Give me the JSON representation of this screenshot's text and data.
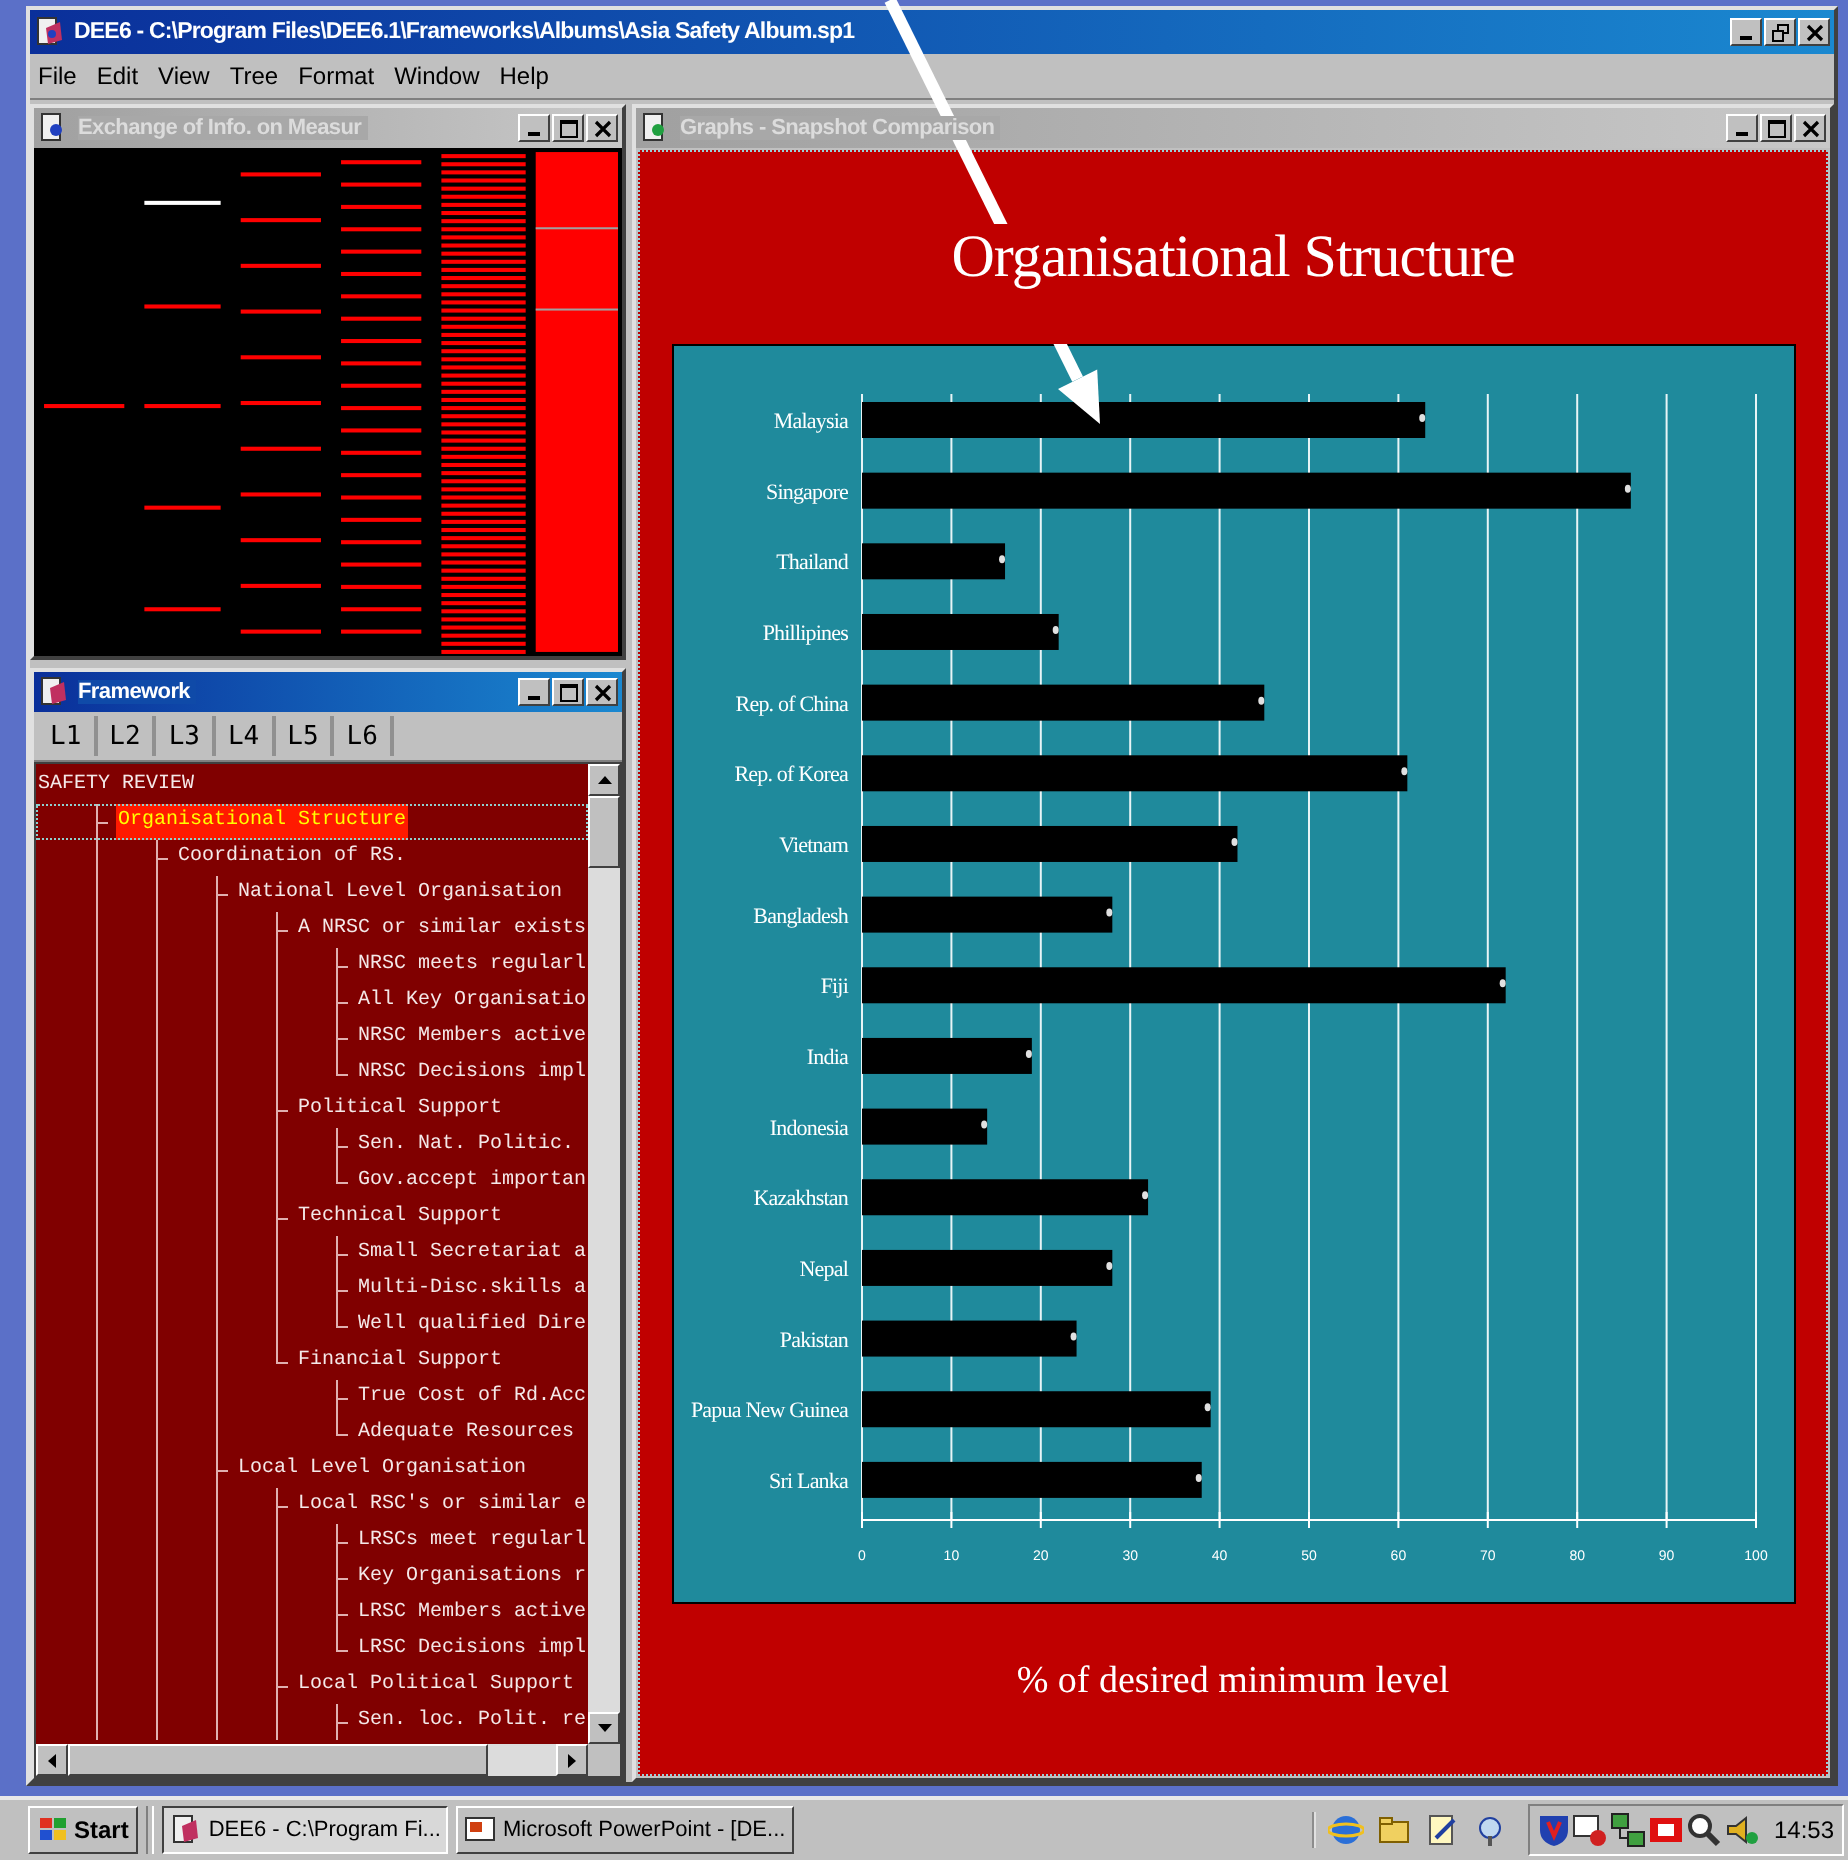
{
  "window": {
    "title": "DEE6 - C:\\Program Files\\DEE6.1\\Frameworks\\Albums\\Asia Safety Album.sp1"
  },
  "menu": [
    "File",
    "Edit",
    "View",
    "Tree",
    "Format",
    "Window",
    "Help"
  ],
  "exchange_window": {
    "title": "Exchange of Info. on Measur",
    "active": false
  },
  "framework_window": {
    "title": "Framework",
    "active": true,
    "level_tabs": [
      "L1",
      "L2",
      "L3",
      "L4",
      "L5",
      "L6"
    ],
    "tree": [
      {
        "label": "SAFETY REVIEW",
        "selected": false,
        "children": [
          {
            "label": "Organisational Structure",
            "selected": true,
            "children": [
              {
                "label": "Coordination of RS.",
                "selected": false,
                "children": [
                  {
                    "label": "National Level Organisation",
                    "selected": false,
                    "children": [
                      {
                        "label": "A NRSC or similar exists",
                        "selected": false,
                        "children": [
                          {
                            "label": "NRSC meets regularl",
                            "selected": false
                          },
                          {
                            "label": "All Key Organisatio",
                            "selected": false
                          },
                          {
                            "label": "NRSC Members active",
                            "selected": false
                          },
                          {
                            "label": "NRSC Decisions impl",
                            "selected": false
                          }
                        ]
                      },
                      {
                        "label": "Political Support",
                        "selected": false,
                        "children": [
                          {
                            "label": "Sen. Nat. Politic.",
                            "selected": false
                          },
                          {
                            "label": "Gov.accept importan",
                            "selected": false
                          }
                        ]
                      },
                      {
                        "label": "Technical Support",
                        "selected": false,
                        "children": [
                          {
                            "label": "Small Secretariat a",
                            "selected": false
                          },
                          {
                            "label": "Multi-Disc.skills a",
                            "selected": false
                          },
                          {
                            "label": "Well qualified Dire",
                            "selected": false
                          }
                        ]
                      },
                      {
                        "label": "Financial Support",
                        "selected": false,
                        "children": [
                          {
                            "label": "True Cost of Rd.Acc",
                            "selected": false
                          },
                          {
                            "label": "Adequate Resources",
                            "selected": false
                          }
                        ]
                      }
                    ]
                  },
                  {
                    "label": "Local Level Organisation",
                    "selected": false,
                    "children": [
                      {
                        "label": "Local RSC's or similar e",
                        "selected": false,
                        "children": [
                          {
                            "label": "LRSCs meet regularl",
                            "selected": false
                          },
                          {
                            "label": "Key Organisations r",
                            "selected": false
                          },
                          {
                            "label": "LRSC Members active",
                            "selected": false
                          },
                          {
                            "label": "LRSC Decisions impl",
                            "selected": false
                          }
                        ]
                      },
                      {
                        "label": "Local Political Support",
                        "selected": false,
                        "children": [
                          {
                            "label": "Sen. loc. Polit. re",
                            "selected": false
                          }
                        ]
                      }
                    ]
                  }
                ]
              }
            ]
          }
        ]
      }
    ]
  },
  "graphs_window": {
    "title": "Graphs - Snapshot Comparison",
    "active": false,
    "chart_data": {
      "type": "bar",
      "orientation": "horizontal",
      "title": "Organisational Structure",
      "xlabel": "% of desired minimum level",
      "categories": [
        "Malaysia",
        "Singapore",
        "Thailand",
        "Phillipines",
        "Rep. of China",
        "Rep. of Korea",
        "Vietnam",
        "Bangladesh",
        "Fiji",
        "India",
        "Indonesia",
        "Kazakhstan",
        "Nepal",
        "Pakistan",
        "Papua New Guinea",
        "Sri Lanka"
      ],
      "series": [
        {
          "color": "#000000",
          "values": [
            63,
            86,
            16,
            22,
            45,
            61,
            42,
            28,
            72,
            19,
            14,
            32,
            28,
            24,
            39,
            38
          ]
        }
      ],
      "grid": true,
      "xlim": [
        0,
        100
      ],
      "xticks": [
        0,
        10,
        20,
        30,
        40,
        50,
        60,
        70,
        80,
        90,
        100
      ]
    }
  },
  "taskbar": {
    "start": "Start",
    "tasks": [
      {
        "label": "DEE6 - C:\\Program Fi...",
        "selected": true
      },
      {
        "label": "Microsoft PowerPoint - [DE...",
        "selected": false
      }
    ],
    "clock": "14:53"
  }
}
